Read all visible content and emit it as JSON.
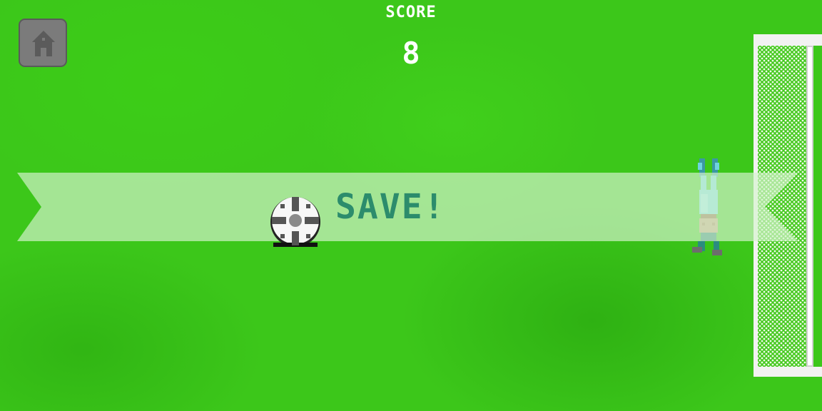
{
  "hud": {
    "score_label": "SCORE",
    "score_value": "8",
    "home_icon": "house-icon"
  },
  "banner": {
    "message": "SAVE!"
  },
  "colors": {
    "grass": "#3cc71a",
    "banner_fill": "#c8efbd",
    "banner_text": "#2c8c6c",
    "hud_text": "#ffffff",
    "home_button": "#7b7b7b",
    "goal_frame": "#f2f2f2"
  },
  "sprites": {
    "ball": "soccer-ball",
    "goalkeeper": "goalkeeper-diving",
    "goal": "goal-net"
  }
}
